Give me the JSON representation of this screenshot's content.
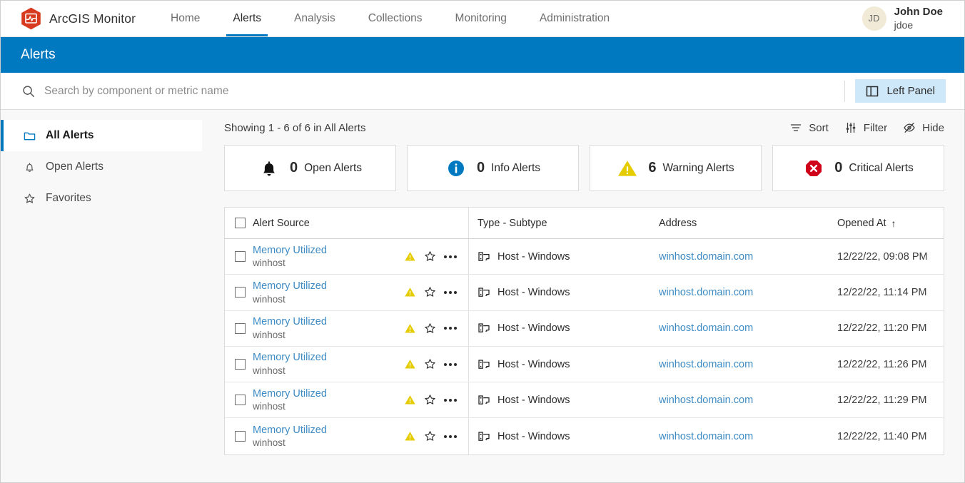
{
  "brand": {
    "name": "ArcGIS Monitor",
    "logo_icon": "arcgis-monitor-hexagon-logo",
    "logo_color": "#d73a1e"
  },
  "nav": {
    "items": [
      {
        "label": "Home",
        "active": false
      },
      {
        "label": "Alerts",
        "active": true
      },
      {
        "label": "Analysis",
        "active": false
      },
      {
        "label": "Collections",
        "active": false
      },
      {
        "label": "Monitoring",
        "active": false
      },
      {
        "label": "Administration",
        "active": false
      }
    ],
    "active_underline_color": "#0079c1"
  },
  "user": {
    "initials": "JD",
    "full_name": "John Doe",
    "username": "jdoe",
    "avatar_color": "#f0ead6"
  },
  "page_header": {
    "title": "Alerts",
    "background_color": "#0079c1"
  },
  "search": {
    "placeholder": "Search by component or metric name",
    "value": "",
    "icon": "search-icon"
  },
  "left_panel_button": {
    "label": "Left Panel",
    "icon": "panel-layout-icon",
    "background_color": "#cfe8f9"
  },
  "sidebar": {
    "items": [
      {
        "label": "All Alerts",
        "icon": "folder-icon",
        "active": true
      },
      {
        "label": "Open Alerts",
        "icon": "bell-icon",
        "active": false
      },
      {
        "label": "Favorites",
        "icon": "star-icon",
        "active": false
      }
    ],
    "active_accent_color": "#0079c1"
  },
  "main": {
    "showing_text": "Showing 1 - 6 of 6 in All Alerts",
    "tools": [
      {
        "label": "Sort",
        "icon": "sort-icon"
      },
      {
        "label": "Filter",
        "icon": "filter-sliders-icon"
      },
      {
        "label": "Hide",
        "icon": "eye-slash-icon"
      }
    ]
  },
  "summary_cards": [
    {
      "count": "0",
      "label": "Open Alerts",
      "icon": "bell-filled-icon",
      "color": "#1a1a1a"
    },
    {
      "count": "0",
      "label": "Info Alerts",
      "icon": "info-circle-icon",
      "color": "#0079c1"
    },
    {
      "count": "6",
      "label": "Warning Alerts",
      "icon": "warning-triangle-icon",
      "color": "#e5cc00"
    },
    {
      "count": "0",
      "label": "Critical Alerts",
      "icon": "critical-octagon-icon",
      "color": "#d0021b"
    }
  ],
  "table": {
    "columns": [
      {
        "label": "Alert Source",
        "sort": ""
      },
      {
        "label": "Type - Subtype",
        "sort": ""
      },
      {
        "label": "Address",
        "sort": ""
      },
      {
        "label": "Opened At",
        "sort": "↑"
      }
    ],
    "rows": [
      {
        "source": "Memory Utilized",
        "source_sub": "winhost",
        "severity": "warning",
        "type": "Host - Windows",
        "type_icon": "host-windows-icon",
        "address": "winhost.domain.com",
        "opened_at": "12/22/22, 09:08 PM",
        "favorite": false,
        "selected": false
      },
      {
        "source": "Memory Utilized",
        "source_sub": "winhost",
        "severity": "warning",
        "type": "Host - Windows",
        "type_icon": "host-windows-icon",
        "address": "winhost.domain.com",
        "opened_at": "12/22/22, 11:14 PM",
        "favorite": false,
        "selected": false
      },
      {
        "source": "Memory Utilized",
        "source_sub": "winhost",
        "severity": "warning",
        "type": "Host - Windows",
        "type_icon": "host-windows-icon",
        "address": "winhost.domain.com",
        "opened_at": "12/22/22, 11:20 PM",
        "favorite": false,
        "selected": false
      },
      {
        "source": "Memory Utilized",
        "source_sub": "winhost",
        "severity": "warning",
        "type": "Host - Windows",
        "type_icon": "host-windows-icon",
        "address": "winhost.domain.com",
        "opened_at": "12/22/22, 11:26 PM",
        "favorite": false,
        "selected": false
      },
      {
        "source": "Memory Utilized",
        "source_sub": "winhost",
        "severity": "warning",
        "type": "Host - Windows",
        "type_icon": "host-windows-icon",
        "address": "winhost.domain.com",
        "opened_at": "12/22/22, 11:29 PM",
        "favorite": false,
        "selected": false
      },
      {
        "source": "Memory Utilized",
        "source_sub": "winhost",
        "severity": "warning",
        "type": "Host - Windows",
        "type_icon": "host-windows-icon",
        "address": "winhost.domain.com",
        "opened_at": "12/22/22, 11:40 PM",
        "favorite": false,
        "selected": false
      }
    ]
  },
  "colors": {
    "brand_blue": "#0079c1",
    "link_blue": "#3e8bc4",
    "warning_yellow": "#e5cc00",
    "critical_red": "#d0021b",
    "page_bg": "#f8f8f8"
  }
}
